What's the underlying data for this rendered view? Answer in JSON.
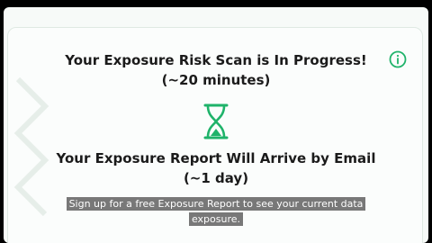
{
  "scan": {
    "title": "Your Exposure Risk Scan is In Progress!",
    "duration": "(~20 minutes)"
  },
  "report": {
    "title": "Your Exposure Report Will Arrive by Email",
    "duration": "(~1 day)"
  },
  "caption": {
    "line1": "Sign up for a free Exposure Report to see your current data",
    "line2": "exposure."
  },
  "icons": {
    "info": "info-icon",
    "hourglass": "hourglass-icon"
  },
  "colors": {
    "accent": "#1fb36a",
    "text": "#1b1b1b",
    "caption_bg": "#606060"
  }
}
